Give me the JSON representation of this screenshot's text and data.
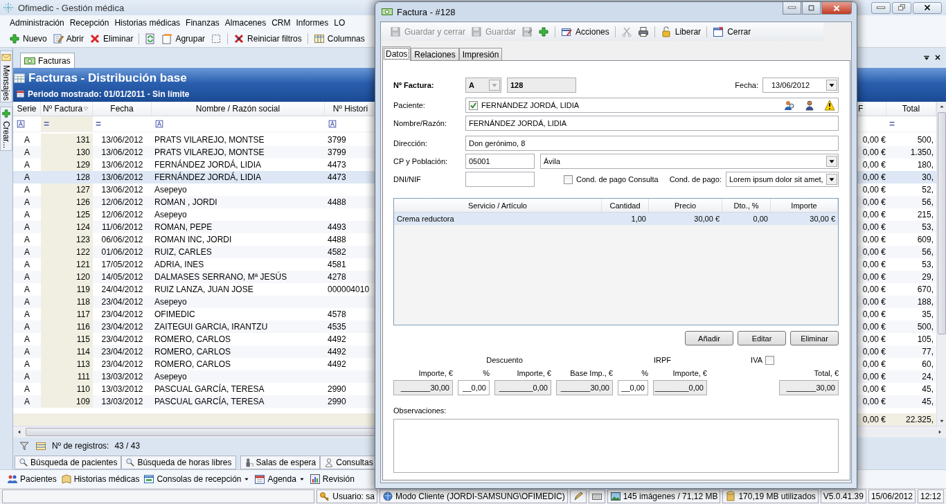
{
  "app": {
    "title": "Ofimedic - Gestión médica"
  },
  "menu": [
    "Administración",
    "Recepción",
    "Historias médicas",
    "Finanzas",
    "Almacenes",
    "CRM",
    "Informes",
    "LO"
  ],
  "toolbar": [
    {
      "kind": "plus",
      "label": "Nuevo"
    },
    {
      "kind": "edit",
      "label": "Abrir"
    },
    {
      "kind": "delete",
      "label": "Eliminar"
    },
    {
      "kind": "separator"
    },
    {
      "kind": "refresh"
    },
    {
      "kind": "group",
      "label": "Agrupar"
    },
    {
      "kind": "select"
    },
    {
      "kind": "separator"
    },
    {
      "kind": "reset",
      "label": "Reiniciar filtros"
    },
    {
      "kind": "separator"
    },
    {
      "kind": "columns",
      "label": "Columnas"
    }
  ],
  "side_panel": [
    {
      "kind": "mail",
      "label": "Mensajes"
    },
    {
      "kind": "plus",
      "label": "Crear..."
    }
  ],
  "document_tabs": [
    {
      "label": "Facturas",
      "selected": true
    }
  ],
  "header": {
    "title": "Facturas - Distribución base",
    "period": "Periodo mostrado: 01/01/2011 - Sin límite"
  },
  "grid": {
    "columns": [
      {
        "label": "Serie",
        "sorted": false
      },
      {
        "label": "Nº Factura",
        "sorted": true
      },
      {
        "label": "Fecha",
        "sorted": false
      },
      {
        "label": "Nombre / Razón social",
        "sorted": false
      },
      {
        "label": "Nº Histori",
        "sorted": false
      },
      {
        "label": "F",
        "sorted": false
      },
      {
        "label": "Total",
        "sorted": false
      }
    ],
    "filters": [
      {
        "kind": "text"
      },
      {
        "kind": "equals",
        "text": "="
      },
      {
        "kind": "equals",
        "text": "="
      },
      {
        "kind": "text"
      },
      {
        "kind": "text"
      },
      {
        "kind": "none"
      },
      {
        "kind": "equals",
        "text": "="
      }
    ],
    "rows": [
      {
        "selected": false,
        "cells": [
          "A",
          "131",
          "13/06/2012",
          "PRATS VILAREJO, MONTSE",
          "3799",
          "0,00 €",
          "500,"
        ]
      },
      {
        "selected": false,
        "cells": [
          "A",
          "130",
          "13/06/2012",
          "PRATS VILAREJO, MONTSE",
          "3799",
          "0,00 €",
          "1.350,"
        ]
      },
      {
        "selected": false,
        "cells": [
          "A",
          "129",
          "13/06/2012",
          "FERNÁNDEZ JORDÁ, LIDIA",
          "4473",
          "0,00 €",
          "180,"
        ]
      },
      {
        "selected": true,
        "cells": [
          "A",
          "128",
          "13/06/2012",
          "FERNÁNDEZ JORDÁ, LIDIA",
          "4473",
          "0,00 €",
          "30,"
        ]
      },
      {
        "selected": false,
        "cells": [
          "A",
          "127",
          "13/06/2012",
          "Asepeyo",
          null,
          "0,00 €",
          "52,"
        ]
      },
      {
        "selected": false,
        "cells": [
          "A",
          "126",
          "12/06/2012",
          "ROMAN , JORDI",
          "4488",
          "0,00 €",
          "56,"
        ]
      },
      {
        "selected": false,
        "cells": [
          "A",
          "125",
          "12/06/2012",
          "Asepeyo",
          null,
          "0,00 €",
          "215,"
        ]
      },
      {
        "selected": false,
        "cells": [
          "A",
          "124",
          "11/06/2012",
          "ROMAN, PEPE",
          "4493",
          "0,00 €",
          "53,"
        ]
      },
      {
        "selected": false,
        "cells": [
          "A",
          "123",
          "06/06/2012",
          "ROMAN INC, JORDI",
          "4488",
          "0,00 €",
          "609,"
        ]
      },
      {
        "selected": false,
        "cells": [
          "A",
          "122",
          "01/06/2012",
          "RUIZ, CARLES",
          "4582",
          "0,00 €",
          "56,"
        ]
      },
      {
        "selected": false,
        "cells": [
          "A",
          "121",
          "17/05/2012",
          "ADRIA, INES",
          "4581",
          "0,00 €",
          "53,"
        ]
      },
      {
        "selected": false,
        "cells": [
          "A",
          "120",
          "14/05/2012",
          "DALMASES SERRANO, Mª JESÚS",
          "4278",
          "0,00 €",
          "29,"
        ]
      },
      {
        "selected": false,
        "cells": [
          "A",
          "119",
          "24/04/2012",
          "RUIZ LANZA, JUAN JOSE",
          "000004010",
          "0,00 €",
          "670,"
        ]
      },
      {
        "selected": false,
        "cells": [
          "A",
          "118",
          "23/04/2012",
          "Asepeyo",
          null,
          "0,00 €",
          "188,"
        ]
      },
      {
        "selected": false,
        "cells": [
          "A",
          "117",
          "23/04/2012",
          "OFIMEDIC",
          "4578",
          "0,00 €",
          "35,"
        ]
      },
      {
        "selected": false,
        "cells": [
          "A",
          "116",
          "23/04/2012",
          "ZAITEGUI GARCIA, IRANTZU",
          "4535",
          "0,00 €",
          "500,"
        ]
      },
      {
        "selected": false,
        "cells": [
          "A",
          "115",
          "23/04/2012",
          "ROMERO, CARLOS",
          "4492",
          "0,00 €",
          "105,"
        ]
      },
      {
        "selected": false,
        "cells": [
          "A",
          "114",
          "23/04/2012",
          "ROMERO, CARLOS",
          "4492",
          "0,00 €",
          "77,"
        ]
      },
      {
        "selected": false,
        "cells": [
          "A",
          "113",
          "23/04/2012",
          "ROMERO, CARLOS",
          "4492",
          "0,00 €",
          "60,"
        ]
      },
      {
        "selected": false,
        "cells": [
          "A",
          "111",
          "13/03/2012",
          "Asepeyo",
          null,
          "0,00 €",
          "24,"
        ]
      },
      {
        "selected": false,
        "cells": [
          "A",
          "110",
          "13/03/2012",
          "PASCUAL GARCÍA, TERESA",
          "2990",
          "0,00 €",
          "45,"
        ]
      },
      {
        "selected": false,
        "cells": [
          "A",
          "109",
          "13/03/2012",
          "PASCUAL GARCÍA, TERESA",
          "2990",
          "0,00 €",
          "45,"
        ]
      }
    ],
    "totals": [
      "0,00 €",
      "22.325,"
    ]
  },
  "records": {
    "label": "Nº de registros:",
    "count": "43 / 43"
  },
  "bottom_tabs": [
    {
      "kind": "search",
      "label": "Búsqueda de pacientes"
    },
    {
      "kind": "search",
      "label": "Búsqueda de horas libres"
    },
    {
      "kind": "waiting",
      "label": "Salas de espera"
    },
    {
      "kind": "consult",
      "label": "Consultas"
    }
  ],
  "launch_bar": [
    {
      "kind": "patients",
      "label": "Pacientes",
      "menu": false
    },
    {
      "kind": "book",
      "label": "Historias médicas",
      "menu": false
    },
    {
      "kind": "console",
      "label": "Consolas de recepción",
      "menu": true
    },
    {
      "kind": "agenda",
      "label": "Agenda",
      "menu": true
    },
    {
      "kind": "review",
      "label": "Revisión",
      "menu": false
    }
  ],
  "status_bar": [
    {
      "kind": "empty"
    },
    {
      "kind": "key",
      "text": "Usuario: sa"
    },
    {
      "kind": "mode",
      "text": "Modo Cliente (JORDI-SAMSUNG\\OFIMEDIC)"
    },
    {
      "kind": "pencil"
    },
    {
      "kind": "keyboard"
    },
    {
      "kind": "images",
      "text": "145 imágenes / 71,12 MB"
    },
    {
      "kind": "db",
      "text": "170,19 MB utilizados"
    },
    {
      "kind": "plain",
      "text": "V5.0.41.39"
    },
    {
      "kind": "plain",
      "text": "15/06/2012"
    },
    {
      "kind": "plain",
      "text": "12:12"
    }
  ],
  "dialog": {
    "title": "Factura - #128",
    "toolbar": [
      {
        "kind": "save",
        "label": "Guardar y cerrar",
        "disabled": true
      },
      {
        "kind": "save",
        "label": "Guardar",
        "disabled": true
      },
      {
        "kind": "save-as",
        "disabled": true
      },
      {
        "kind": "plus",
        "disabled": false
      },
      {
        "kind": "separator"
      },
      {
        "kind": "actions",
        "label": "Acciones",
        "disabled": false
      },
      {
        "kind": "separator"
      },
      {
        "kind": "cut",
        "disabled": true
      },
      {
        "kind": "print",
        "disabled": false
      },
      {
        "kind": "separator"
      },
      {
        "kind": "lock",
        "label": "Liberar",
        "disabled": false
      },
      {
        "kind": "separator"
      },
      {
        "kind": "close-doc",
        "label": "Cerrar",
        "disabled": false
      }
    ],
    "tabs": [
      {
        "label": "Datos",
        "selected": true
      },
      {
        "label": "Relaciones",
        "selected": false
      },
      {
        "label": "Impresión",
        "selected": false
      }
    ],
    "form": {
      "invoice_label": "Nº Factura:",
      "series": "A",
      "number": "128",
      "date_label": "Fecha:",
      "date": "13/06/2012",
      "patient_label": "Paciente:",
      "patient_checked": true,
      "patient": "FERNÁNDEZ JORDÁ, LIDIA",
      "name_label": "Nombre/Razón:",
      "name": "FERNÁNDEZ JORDÁ, LIDIA",
      "address_label": "Dirección:",
      "address": "Don gerónimo, 8",
      "postal_label": "CP y Población:",
      "postal_code": "05001",
      "city": "Ávila",
      "tax_id_label": "DNI/NIF",
      "consult_terms_label": "Cond. de pago Consulta",
      "consult_terms_checked": false,
      "terms_label": "Cond. de pago:",
      "terms": "Lorem ipsum dolor sit amet,"
    },
    "lines": {
      "columns": [
        "Servicio / Artículo",
        "Cantidad",
        "Precio",
        "Dto., %",
        "Importe"
      ],
      "rows": [
        {
          "selected": true,
          "cells": [
            "Crema reductora",
            "1,00",
            "30,00 €",
            "0,00",
            "30,00 €"
          ]
        }
      ]
    },
    "line_buttons": [
      "Añadir",
      "Editar",
      "Eliminar"
    ],
    "totals": {
      "discount_label": "Descuento",
      "irpf_label": "IRPF",
      "vat_label": "IVA",
      "vat_checked": false,
      "fields": [
        {
          "label": "Importe, €",
          "value": "_______30,00",
          "readonly": true
        },
        {
          "label": "%",
          "value": "__0,00",
          "readonly": false
        },
        {
          "label": "Importe, €",
          "value": "________0,00",
          "readonly": true
        },
        {
          "label": "Base Imp., €",
          "value": "_______30,00",
          "readonly": true
        },
        {
          "label": "%",
          "value": "__0,00",
          "readonly": false
        },
        {
          "label": "Importe, €",
          "value": "________0,00",
          "readonly": true
        },
        {
          "label": "Total, €",
          "value": "_______30,00",
          "readonly": true
        }
      ]
    },
    "notes_label": "Observaciones:"
  }
}
